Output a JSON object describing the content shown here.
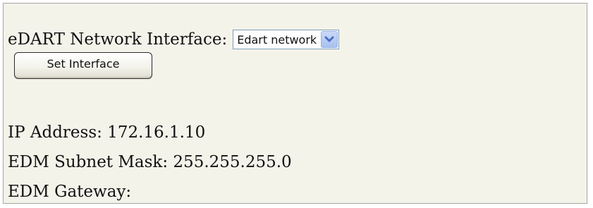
{
  "form": {
    "interface_label": "eDART Network Interface:",
    "interface_select": {
      "selected_value": "Edart network",
      "arrow_icon": "chevron-down-icon"
    },
    "set_button_label": "Set Interface"
  },
  "network_info": {
    "ip_address": "IP Address: 172.16.1.10",
    "subnet_mask": "EDM Subnet Mask: 255.255.255.0",
    "gateway": "EDM Gateway:"
  },
  "colors": {
    "panel_background": "#f4f3ea",
    "select_border": "#7f9db9",
    "dropdown_arrow": "#4a6fc4"
  }
}
